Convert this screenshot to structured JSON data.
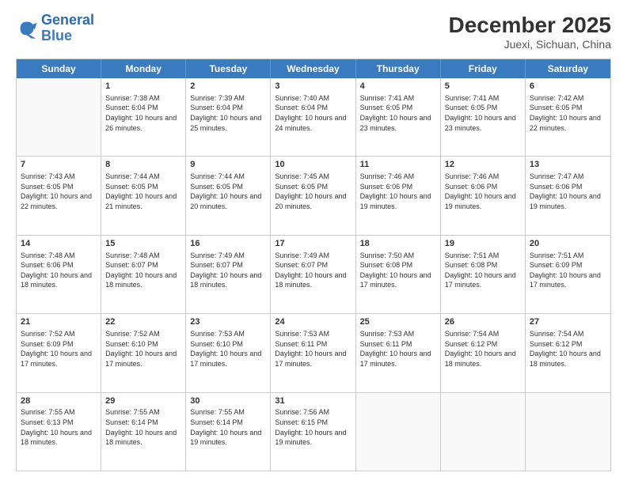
{
  "logo": {
    "line1": "General",
    "line2": "Blue"
  },
  "header": {
    "month": "December 2025",
    "location": "Juexi, Sichuan, China"
  },
  "days": [
    "Sunday",
    "Monday",
    "Tuesday",
    "Wednesday",
    "Thursday",
    "Friday",
    "Saturday"
  ],
  "weeks": [
    [
      {
        "day": "",
        "empty": true
      },
      {
        "day": "1",
        "sunrise": "7:38 AM",
        "sunset": "6:04 PM",
        "daylight": "10 hours and 26 minutes."
      },
      {
        "day": "2",
        "sunrise": "7:39 AM",
        "sunset": "6:04 PM",
        "daylight": "10 hours and 25 minutes."
      },
      {
        "day": "3",
        "sunrise": "7:40 AM",
        "sunset": "6:04 PM",
        "daylight": "10 hours and 24 minutes."
      },
      {
        "day": "4",
        "sunrise": "7:41 AM",
        "sunset": "6:05 PM",
        "daylight": "10 hours and 23 minutes."
      },
      {
        "day": "5",
        "sunrise": "7:41 AM",
        "sunset": "6:05 PM",
        "daylight": "10 hours and 23 minutes."
      },
      {
        "day": "6",
        "sunrise": "7:42 AM",
        "sunset": "6:05 PM",
        "daylight": "10 hours and 22 minutes."
      }
    ],
    [
      {
        "day": "7",
        "sunrise": "7:43 AM",
        "sunset": "6:05 PM",
        "daylight": "10 hours and 22 minutes."
      },
      {
        "day": "8",
        "sunrise": "7:44 AM",
        "sunset": "6:05 PM",
        "daylight": "10 hours and 21 minutes."
      },
      {
        "day": "9",
        "sunrise": "7:44 AM",
        "sunset": "6:05 PM",
        "daylight": "10 hours and 20 minutes."
      },
      {
        "day": "10",
        "sunrise": "7:45 AM",
        "sunset": "6:05 PM",
        "daylight": "10 hours and 20 minutes."
      },
      {
        "day": "11",
        "sunrise": "7:46 AM",
        "sunset": "6:06 PM",
        "daylight": "10 hours and 19 minutes."
      },
      {
        "day": "12",
        "sunrise": "7:46 AM",
        "sunset": "6:06 PM",
        "daylight": "10 hours and 19 minutes."
      },
      {
        "day": "13",
        "sunrise": "7:47 AM",
        "sunset": "6:06 PM",
        "daylight": "10 hours and 19 minutes."
      }
    ],
    [
      {
        "day": "14",
        "sunrise": "7:48 AM",
        "sunset": "6:06 PM",
        "daylight": "10 hours and 18 minutes."
      },
      {
        "day": "15",
        "sunrise": "7:48 AM",
        "sunset": "6:07 PM",
        "daylight": "10 hours and 18 minutes."
      },
      {
        "day": "16",
        "sunrise": "7:49 AM",
        "sunset": "6:07 PM",
        "daylight": "10 hours and 18 minutes."
      },
      {
        "day": "17",
        "sunrise": "7:49 AM",
        "sunset": "6:07 PM",
        "daylight": "10 hours and 18 minutes."
      },
      {
        "day": "18",
        "sunrise": "7:50 AM",
        "sunset": "6:08 PM",
        "daylight": "10 hours and 17 minutes."
      },
      {
        "day": "19",
        "sunrise": "7:51 AM",
        "sunset": "6:08 PM",
        "daylight": "10 hours and 17 minutes."
      },
      {
        "day": "20",
        "sunrise": "7:51 AM",
        "sunset": "6:09 PM",
        "daylight": "10 hours and 17 minutes."
      }
    ],
    [
      {
        "day": "21",
        "sunrise": "7:52 AM",
        "sunset": "6:09 PM",
        "daylight": "10 hours and 17 minutes."
      },
      {
        "day": "22",
        "sunrise": "7:52 AM",
        "sunset": "6:10 PM",
        "daylight": "10 hours and 17 minutes."
      },
      {
        "day": "23",
        "sunrise": "7:53 AM",
        "sunset": "6:10 PM",
        "daylight": "10 hours and 17 minutes."
      },
      {
        "day": "24",
        "sunrise": "7:53 AM",
        "sunset": "6:11 PM",
        "daylight": "10 hours and 17 minutes."
      },
      {
        "day": "25",
        "sunrise": "7:53 AM",
        "sunset": "6:11 PM",
        "daylight": "10 hours and 17 minutes."
      },
      {
        "day": "26",
        "sunrise": "7:54 AM",
        "sunset": "6:12 PM",
        "daylight": "10 hours and 18 minutes."
      },
      {
        "day": "27",
        "sunrise": "7:54 AM",
        "sunset": "6:12 PM",
        "daylight": "10 hours and 18 minutes."
      }
    ],
    [
      {
        "day": "28",
        "sunrise": "7:55 AM",
        "sunset": "6:13 PM",
        "daylight": "10 hours and 18 minutes."
      },
      {
        "day": "29",
        "sunrise": "7:55 AM",
        "sunset": "6:14 PM",
        "daylight": "10 hours and 18 minutes."
      },
      {
        "day": "30",
        "sunrise": "7:55 AM",
        "sunset": "6:14 PM",
        "daylight": "10 hours and 19 minutes."
      },
      {
        "day": "31",
        "sunrise": "7:56 AM",
        "sunset": "6:15 PM",
        "daylight": "10 hours and 19 minutes."
      },
      {
        "day": "",
        "empty": true
      },
      {
        "day": "",
        "empty": true
      },
      {
        "day": "",
        "empty": true
      }
    ]
  ],
  "labels": {
    "sunrise": "Sunrise:",
    "sunset": "Sunset:",
    "daylight": "Daylight:"
  }
}
